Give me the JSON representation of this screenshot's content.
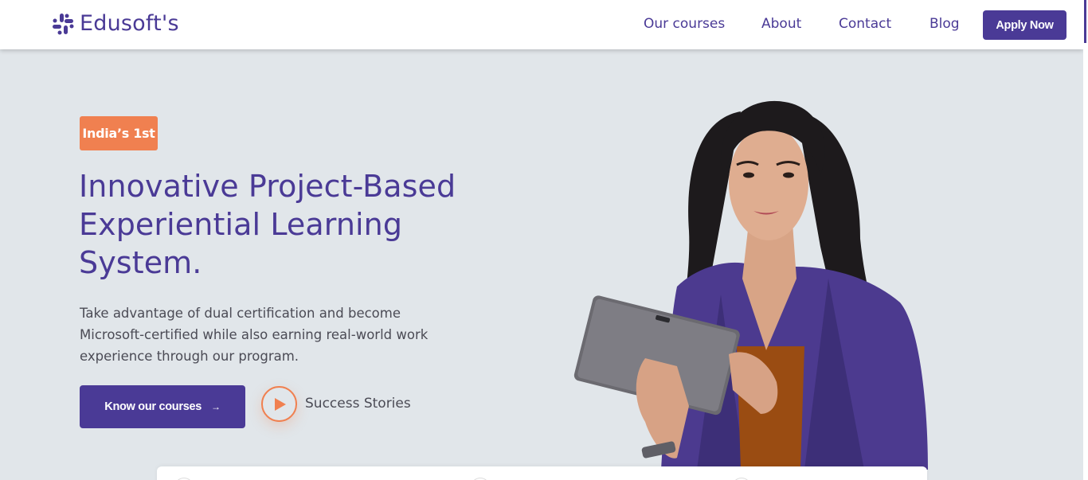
{
  "brand": {
    "name": "Edusoft's"
  },
  "nav": {
    "links": [
      "Our courses",
      "About",
      "Contact",
      "Blog"
    ],
    "apply_label": "Apply Now"
  },
  "hero": {
    "badge": "India’s 1st",
    "headline_lines": [
      "Innovative Project-Based",
      "Experiential Learning",
      "System."
    ],
    "description_lines": [
      "Take advantage of dual certification and become",
      "Microsoft-certified while also earning real-world work",
      "experience through our program."
    ],
    "cta_label": "Know our courses",
    "cta_arrow": "→",
    "play_label": "Success Stories"
  },
  "colors": {
    "brand_purple": "#4a3a96",
    "accent_orange": "#f08050",
    "hero_background": "#e1e6ea"
  },
  "icons": {
    "logo": "slack-style-hash-icon",
    "play": "play-icon",
    "arrow": "arrow-right-icon"
  }
}
